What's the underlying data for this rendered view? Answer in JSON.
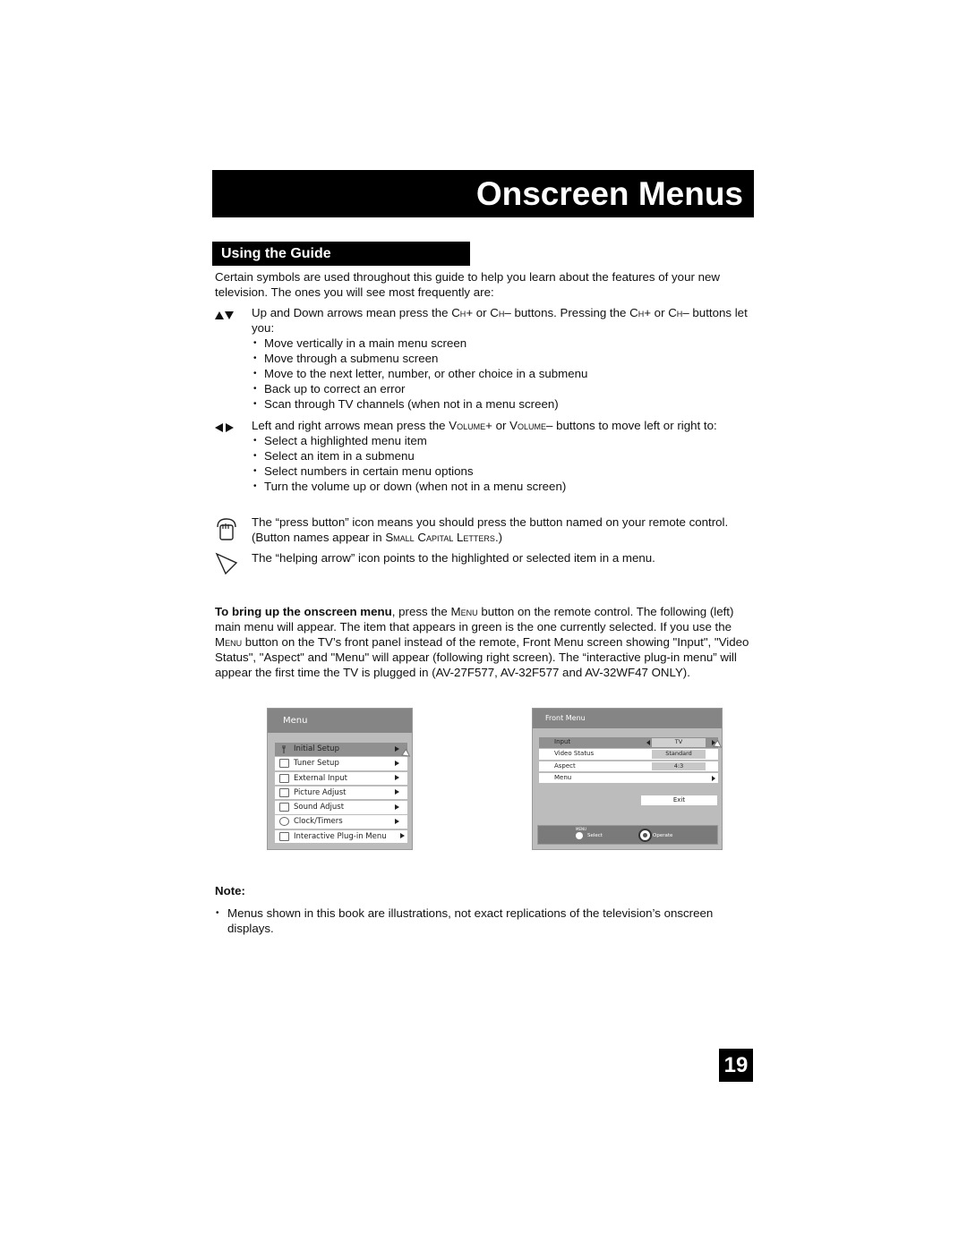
{
  "page": {
    "title": "Onscreen Menus",
    "section_title": "Using the Guide",
    "page_number": "19"
  },
  "intro": "Certain symbols are used throughout this guide to help you learn about the features of your new television. The ones you will see most frequently are:",
  "symbols": {
    "updown": {
      "icon": "up-down-arrows-icon",
      "text_a": "Up and Down arrows mean press the ",
      "sc1": "Ch",
      "text_b": "+ or ",
      "sc2": "Ch",
      "text_c": "– buttons. Pressing the ",
      "sc3": "Ch",
      "text_d": "+ or ",
      "sc4": "Ch",
      "text_e": "– buttons let you:",
      "bullets": [
        "Move vertically in a main menu screen",
        "Move through a submenu screen",
        "Move to the next letter, number, or other choice in a submenu",
        "Back up to correct an error",
        "Scan through TV channels (when not in a menu screen)"
      ]
    },
    "leftright": {
      "icon": "left-right-arrows-icon",
      "text_a": "Left and right arrows mean press the ",
      "sc1": "Volume",
      "text_b": "+ or  ",
      "sc2": "Volume",
      "text_c": "– buttons to move left or right to:",
      "bullets": [
        "Select a highlighted menu item",
        "Select an item in a submenu",
        "Select numbers in certain menu options",
        "Turn the volume up or down (when not in a menu screen)"
      ]
    },
    "press": {
      "icon": "press-button-icon",
      "text_a": "The “press button” icon means you should press the button named on your remote control. (Button names appear in ",
      "sc1": "Small Capital Letters",
      "text_b": ".)"
    },
    "help": {
      "icon": "helping-arrow-icon",
      "text": "The “helping arrow” icon points to the highlighted or selected item in a menu."
    }
  },
  "para2": {
    "bold": "To bring up the onscreen menu",
    "text_a": ", press the ",
    "sc1": "Menu",
    "text_b": " button on the remote control. The following (left) main menu will appear.  The item that appears in green is the one currently selected. If you use the ",
    "sc2": "Menu",
    "text_c": " button on the TV’s front panel instead of the remote, Front Menu screen showing \"Input\", \"Video Status\", \"Aspect\" and \"Menu\" will appear (following right screen). The “interactive plug-in menu” will appear the first time the TV is plugged in (AV-27F577, AV-32F577 and AV-32WF47 ONLY)."
  },
  "main_menu": {
    "title": "Menu",
    "items": [
      {
        "label": "Initial Setup",
        "icon": "wrench-icon",
        "selected": true
      },
      {
        "label": "Tuner Setup",
        "icon": "tuner-icon",
        "selected": false
      },
      {
        "label": "External Input",
        "icon": "external-input-icon",
        "selected": false
      },
      {
        "label": "Picture Adjust",
        "icon": "monitor-icon",
        "selected": false
      },
      {
        "label": "Sound Adjust",
        "icon": "speaker-monitor-icon",
        "selected": false
      },
      {
        "label": "Clock/Timers",
        "icon": "clock-icon",
        "selected": false
      },
      {
        "label": "Interactive Plug-in Menu",
        "icon": "plug-in-icon",
        "selected": false
      }
    ]
  },
  "front_menu": {
    "title": "Front Menu",
    "rows": [
      {
        "label": "Input",
        "value": "TV",
        "selected": true
      },
      {
        "label": "Video Status",
        "value": "Standard",
        "selected": false
      },
      {
        "label": "Aspect",
        "value": "4:3",
        "selected": false
      },
      {
        "label": "Menu",
        "value": "",
        "selected": false
      }
    ],
    "exit_label": "Exit",
    "footer": {
      "menu_label": "MENU",
      "select_label": "Select",
      "operate_label": "Operate"
    }
  },
  "note": {
    "label": "Note:",
    "items": [
      "Menus shown in this book are illustrations, not exact replications of the television’s onscreen displays."
    ]
  }
}
